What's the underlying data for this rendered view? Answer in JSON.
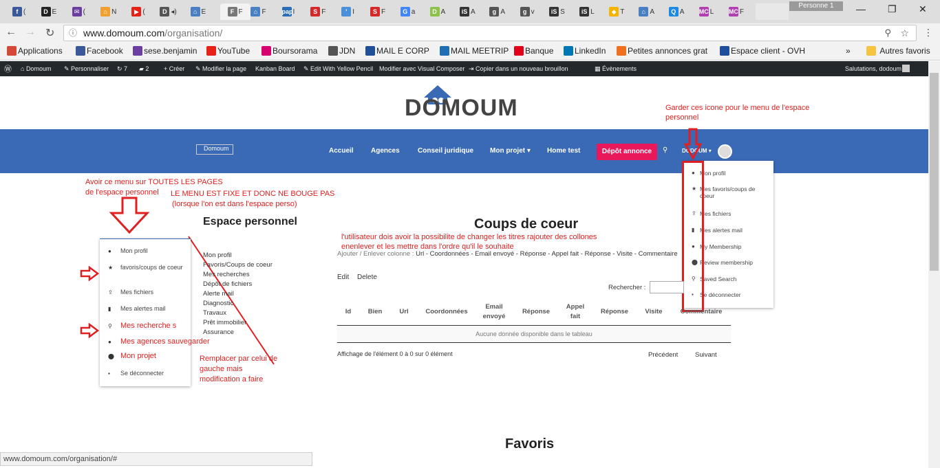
{
  "browser": {
    "tabs": [
      {
        "letter": "f",
        "color": "#3b5998",
        "text": "("
      },
      {
        "letter": "D",
        "color": "#222222",
        "text": "E"
      },
      {
        "letter": "✉",
        "color": "#6b3fa0",
        "text": "("
      },
      {
        "letter": "⌂",
        "color": "#f0a030",
        "text": "N"
      },
      {
        "letter": "▶",
        "color": "#e62117",
        "text": "("
      },
      {
        "letter": "D",
        "color": "#555555",
        "text": "◂)"
      },
      {
        "letter": "⌂",
        "color": "#4a7fc1",
        "text": "E"
      },
      {
        "letter": "F",
        "color": "#777777",
        "text": "F"
      },
      {
        "letter": "⌂",
        "color": "#4a7fc1",
        "text": "F"
      },
      {
        "letter": "pap",
        "color": "#2a6eb5",
        "text": "I"
      },
      {
        "letter": "S",
        "color": "#d62828",
        "text": "F"
      },
      {
        "letter": "’",
        "color": "#4a90d9",
        "text": "I"
      },
      {
        "letter": "S",
        "color": "#d62828",
        "text": "F"
      },
      {
        "letter": "G",
        "color": "#4285f4",
        "text": "a"
      },
      {
        "letter": "D",
        "color": "#8bc34a",
        "text": "A"
      },
      {
        "letter": "iS",
        "color": "#333333",
        "text": "A"
      },
      {
        "letter": "g",
        "color": "#555555",
        "text": "A"
      },
      {
        "letter": "g",
        "color": "#555555",
        "text": "v"
      },
      {
        "letter": "iS",
        "color": "#333333",
        "text": "S"
      },
      {
        "letter": "iS",
        "color": "#333333",
        "text": "L"
      },
      {
        "letter": "◆",
        "color": "#f5b400",
        "text": "T"
      },
      {
        "letter": "⌂",
        "color": "#4a7fc1",
        "text": "A"
      },
      {
        "letter": "Q",
        "color": "#1e88e5",
        "text": "A"
      },
      {
        "letter": "MC",
        "color": "#b040b0",
        "text": "L"
      },
      {
        "letter": "MC",
        "color": "#b040b0",
        "text": "F"
      }
    ],
    "profile": "Personne 1",
    "url_host": "www.domoum.com",
    "url_path": "/organisation/",
    "bookmarks": [
      {
        "label": "Applications",
        "icon": "apps-icon",
        "color": "#d34836"
      },
      {
        "label": "Facebook",
        "icon": "facebook-icon",
        "color": "#3b5998"
      },
      {
        "label": "sese.benjamin",
        "icon": "mail-icon",
        "color": "#6b3fa0"
      },
      {
        "label": "YouTube",
        "icon": "youtube-icon",
        "color": "#e62117"
      },
      {
        "label": "Boursorama",
        "icon": "boursorama-icon",
        "color": "#d6006f"
      },
      {
        "label": "JDN",
        "icon": "jdn-icon",
        "color": "#555555"
      },
      {
        "label": "MAIL E CORP",
        "icon": "corp-icon",
        "color": "#1f4f9a"
      },
      {
        "label": "MAIL MEETRIP",
        "icon": "meetrip-icon",
        "color": "#1f6fb5"
      },
      {
        "label": "Banque",
        "icon": "bank-icon",
        "color": "#e2001a"
      },
      {
        "label": "LinkedIn",
        "icon": "linkedin-icon",
        "color": "#0077b5"
      },
      {
        "label": "Petites annonces grat",
        "icon": "box-icon",
        "color": "#f07020"
      },
      {
        "label": "Espace client - OVH",
        "icon": "ovh-icon",
        "color": "#1f4f9a"
      }
    ],
    "bookmarks_more": "»",
    "other_bookmarks": "Autres favoris",
    "status_url": "www.domoum.com/organisation/#"
  },
  "wpbar": {
    "items": [
      {
        "label": "Domoum",
        "icon": "home-icon"
      },
      {
        "label": "Personnaliser",
        "icon": "brush-icon"
      },
      {
        "label": "7",
        "icon": "refresh-icon"
      },
      {
        "label": "2",
        "icon": "comment-icon"
      },
      {
        "label": "Créer",
        "icon": "plus-icon"
      },
      {
        "label": "Modifier la page",
        "icon": "pencil-icon"
      },
      {
        "label": "Kanban Board",
        "icon": ""
      },
      {
        "label": "Edit With Yellow Pencil",
        "icon": "pencil-icon"
      },
      {
        "label": "Modifier avec Visual Composer",
        "icon": ""
      },
      {
        "label": "Copier dans un nouveau brouillon",
        "icon": "copy-icon"
      },
      {
        "label": "Évènements",
        "icon": "calendar-icon"
      }
    ],
    "greeting": "Salutations, dodoum"
  },
  "site": {
    "logo": "DOMOUM",
    "logo_alt": "Domoum",
    "nav": [
      "Accueil",
      "Agences",
      "Conseil juridique",
      "Mon projet",
      "Home test"
    ],
    "depot": "Dépôt annonce",
    "user": "DODOUM"
  },
  "dropdown": [
    {
      "label": "Mon profil",
      "icon": "user-icon"
    },
    {
      "label": "Mes favoris/coups de coeur",
      "icon": "star-icon"
    },
    {
      "label": "Mes fichiers",
      "icon": "upload-icon"
    },
    {
      "label": "Mes alertes mail",
      "icon": "book-icon"
    },
    {
      "label": "My Membership",
      "icon": "user-icon"
    },
    {
      "label": "Review membership",
      "icon": "circle-icon"
    },
    {
      "label": "Saved Search",
      "icon": "search-icon"
    },
    {
      "label": "Se déconnecter",
      "icon": "unlock-icon"
    }
  ],
  "annotations": {
    "keep_icons": "Garder ces icone pour le menu de l'espace personnel",
    "menu_all_pages_1": "Avoir ce menu sur TOUTES LES PAGES",
    "menu_all_pages_2": "de l'espace personnel",
    "menu_fixed_1": "LE MENU EST FIXE ET DONC NE BOUGE PAS",
    "menu_fixed_2": "(lorsque l'on est dans l'espace perso)",
    "columns_1": "l'utilisateur dois avoir la possibilite de changer les titres rajouter des collones",
    "columns_2": "enenlever et les mettre dans l'ordre qu'il le souhaite",
    "replace_1": "Remplacer par celui de",
    "replace_2": "gauche mais",
    "replace_3": "modification a faire"
  },
  "espace": {
    "title": "Espace personnel",
    "left_menu": [
      {
        "label": "Mon profil",
        "icon": "user-icon",
        "red": false
      },
      {
        "label": "favoris/coups de coeur",
        "icon": "star-icon",
        "red": false
      },
      {
        "label": "Mes fichiers",
        "icon": "upload-icon",
        "red": false
      },
      {
        "label": "Mes alertes mail",
        "icon": "book-icon",
        "red": false
      },
      {
        "label": "Mes recherche s",
        "icon": "search-icon",
        "red": true
      },
      {
        "label": "Mes agences sauvegarder",
        "icon": "user-icon",
        "red": true
      },
      {
        "label": "Mon projet",
        "icon": "circle-icon",
        "red": true
      },
      {
        "label": "Se déconnecter",
        "icon": "unlock-icon",
        "red": false
      }
    ],
    "sub_links": [
      "Mon profil",
      "Favoris/Coups de coeur",
      "Mes recherches",
      "Dépôt de fichiers",
      "Alerte mail",
      "Diagnostic",
      "Travaux",
      "Prêt immobilier",
      "Assurance"
    ]
  },
  "coups": {
    "title": "Coups de coeur",
    "columns_label": "Ajouter / Enlever colonne :",
    "column_toggles": "Url - Coordonnées - Email envoyé - Réponse - Appel fait - Réponse - Visite - Commentaire",
    "edit": "Edit",
    "delete": "Delete",
    "search_label": "Rechercher :",
    "headers": [
      "Id",
      "Bien",
      "Url",
      "Coordonnées",
      "Email envoyé",
      "Réponse",
      "Appel fait",
      "Réponse",
      "Visite",
      "Commentaire"
    ],
    "empty": "Aucune donnée disponible dans le tableau",
    "info": "Affichage de l'élément 0 à 0 sur 0 élément",
    "prev": "Précédent",
    "next": "Suivant"
  },
  "favoris": {
    "title": "Favoris"
  }
}
